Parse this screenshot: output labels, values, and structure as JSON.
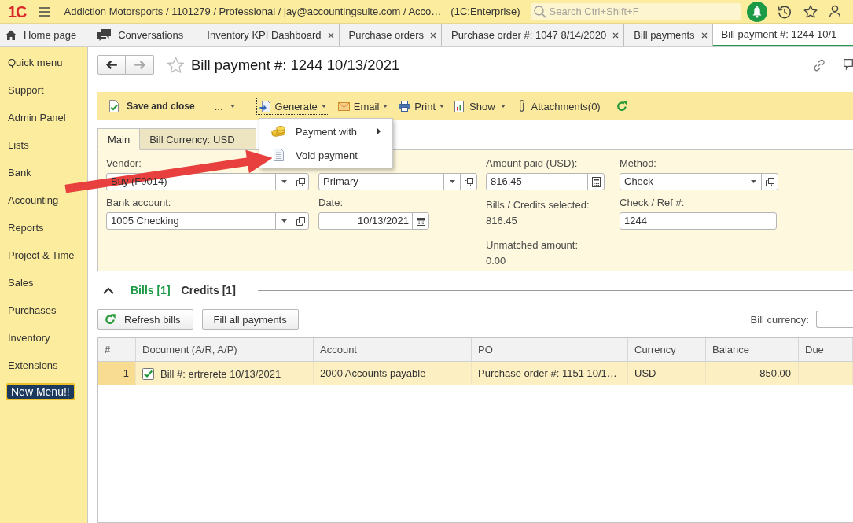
{
  "app_bar": {
    "logo": "1C",
    "title": "Addiction Motorsports / 1101279 / Professional / jay@accountingsuite.com / Acco…",
    "platform": "(1C:Enterprise)",
    "search": {
      "placeholder": "Search Ctrl+Shift+F"
    }
  },
  "open_tabs": [
    {
      "label": "Home page",
      "kind": "home",
      "closable": false,
      "selected": false
    },
    {
      "label": "Conversations",
      "kind": "chat",
      "closable": false,
      "selected": false
    },
    {
      "label": "Inventory KPI Dashboard",
      "kind": "page",
      "closable": true,
      "selected": false
    },
    {
      "label": "Purchase orders",
      "kind": "page",
      "closable": true,
      "selected": false
    },
    {
      "label": "Purchase order #: 1047 8/14/2020",
      "kind": "page",
      "closable": true,
      "selected": false
    },
    {
      "label": "Bill payments",
      "kind": "page",
      "closable": true,
      "selected": false
    },
    {
      "label": "Bill payment #: 1244 10/1",
      "kind": "page",
      "closable": false,
      "selected": true
    }
  ],
  "sidebar": {
    "items": [
      {
        "label": "Quick menu",
        "kind": "link"
      },
      {
        "label": "Support",
        "kind": "link"
      },
      {
        "label": "Admin Panel",
        "kind": "link"
      },
      {
        "label": "Lists",
        "kind": "link"
      },
      {
        "label": "Bank",
        "kind": "link"
      },
      {
        "label": "Accounting",
        "kind": "link"
      },
      {
        "label": "Reports",
        "kind": "link"
      },
      {
        "label": "Project & Time",
        "kind": "link"
      },
      {
        "label": "Sales",
        "kind": "link"
      },
      {
        "label": "Purchases",
        "kind": "link"
      },
      {
        "label": "Inventory",
        "kind": "link"
      },
      {
        "label": "Extensions",
        "kind": "link"
      },
      {
        "label": "New Menu!!",
        "kind": "button"
      }
    ]
  },
  "document": {
    "nav": [
      {
        "kind": "back",
        "disabled": false
      },
      {
        "kind": "forward",
        "disabled": true
      }
    ],
    "favorite": false,
    "title": "Bill payment #: 1244 10/13/2021"
  },
  "command_bar": {
    "items": [
      {
        "kind": "save",
        "label": "Save and close",
        "dropdown": false
      },
      {
        "kind": "more",
        "label": "...",
        "dropdown": true
      },
      {
        "kind": "generate",
        "label": "Generate",
        "dropdown": true,
        "expanded": true,
        "menu": [
          {
            "kind": "coins",
            "label": "Payment with",
            "submenu": true
          },
          {
            "kind": "document",
            "label": "Void payment",
            "submenu": false
          }
        ]
      },
      {
        "kind": "email",
        "label": "Email",
        "dropdown": true
      },
      {
        "kind": "print",
        "label": "Print",
        "dropdown": true
      },
      {
        "kind": "show",
        "label": "Show",
        "dropdown": true
      },
      {
        "kind": "attachments",
        "label": "Attachments(0)",
        "dropdown": false
      },
      {
        "kind": "refresh",
        "dropdown": false
      }
    ]
  },
  "form_tabs": [
    {
      "label": "Main",
      "selected": true
    },
    {
      "label": "Bill Currency: USD",
      "selected": false
    },
    {
      "selected": false
    }
  ],
  "form": {
    "columns": [
      [
        {
          "kind": "combo",
          "label": "Vendor:",
          "value": "Buy (F0014)"
        },
        {
          "kind": "combo",
          "label": "Bank account:",
          "value": "1005 Checking"
        }
      ],
      [
        {
          "kind": "combo",
          "value": "Primary"
        },
        {
          "kind": "date",
          "label": "Date:",
          "value": "10/13/2021"
        }
      ],
      [
        {
          "kind": "number",
          "label": "Amount paid (USD):",
          "value": "816.45"
        },
        {
          "kind": "readout",
          "label": "Bills / Credits selected:",
          "value": "816.45"
        },
        {
          "kind": "readout",
          "label": "Unmatched amount:",
          "value": "0.00"
        }
      ],
      [
        {
          "kind": "combo",
          "label": "Method:",
          "value": "Check"
        },
        {
          "kind": "text",
          "label": "Check / Ref #:",
          "value": "1244"
        }
      ]
    ]
  },
  "lines": {
    "expanded": true,
    "tabs": [
      {
        "label": "Bills [1]",
        "selected": true
      },
      {
        "label": "Credits [1]",
        "selected": false
      }
    ],
    "buttons": [
      {
        "kind": "refresh",
        "label": "Refresh bills"
      },
      {
        "kind": "plain",
        "label": "Fill all payments"
      }
    ],
    "currency_filter": {
      "label": "Bill currency:"
    }
  },
  "table": {
    "columns": [
      {
        "label": "#",
        "kind": "index"
      },
      {
        "label": "Document (A/R, A/P)",
        "kind": "document"
      },
      {
        "label": "Account",
        "kind": "text"
      },
      {
        "label": "PO",
        "kind": "text"
      },
      {
        "label": "Currency",
        "kind": "text"
      },
      {
        "label": "Balance",
        "kind": "amount"
      },
      {
        "label": "Due"
      }
    ],
    "rows": [
      {
        "selected": true,
        "checked": true,
        "cells": [
          "1",
          "Bill #: ertrerete 10/13/2021",
          "2000 Accounts payable",
          "Purchase order #: 1151 10/1…",
          "USD",
          "850.00"
        ]
      }
    ]
  },
  "annotation": {
    "kind": "arrow"
  }
}
